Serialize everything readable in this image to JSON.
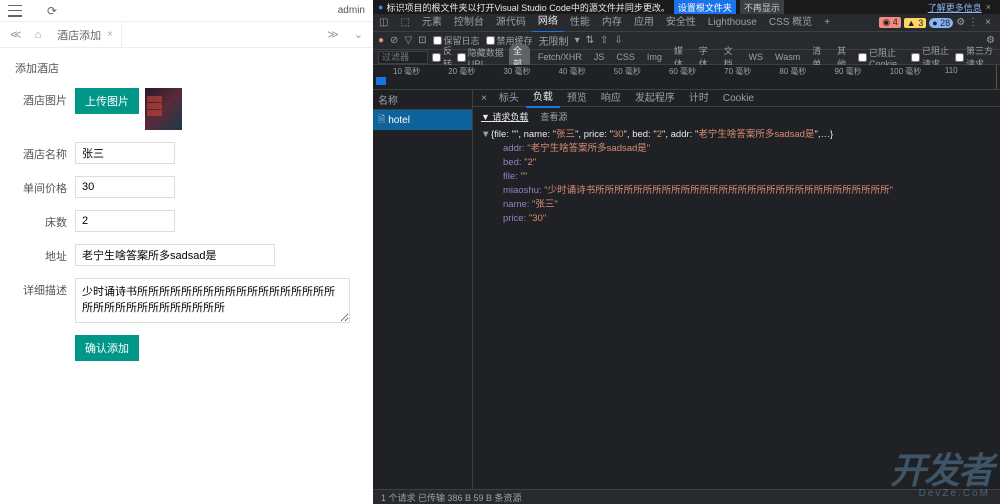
{
  "app": {
    "user": "admin",
    "tab_label": "酒店添加",
    "page_title": "添加酒店"
  },
  "form": {
    "img_label": "酒店图片",
    "upload_btn": "上传图片",
    "name_label": "酒店名称",
    "name_value": "张三",
    "price_label": "单间价格",
    "price_value": "30",
    "bed_label": "床数",
    "bed_value": "2",
    "addr_label": "地址",
    "addr_value": "老宁生啥答案所多sadsad是",
    "desc_label": "详细描述",
    "desc_value": "少时诵诗书所所所所所所所所所所所所所所所所所所所所所所所所所所所所所所所",
    "submit_btn": "确认添加"
  },
  "devtools": {
    "notice": "标识项目的根文件夹以打开Visual Studio Code中的源文件并同步更改。",
    "notice_btn1": "设置根文件夹",
    "notice_btn2": "不再显示",
    "notice_link": "了解更多信息",
    "tabs": [
      "元素",
      "控制台",
      "源代码",
      "网络",
      "性能",
      "内存",
      "应用",
      "安全性",
      "Lighthouse",
      "CSS 概览"
    ],
    "active_tab": "网络",
    "badges": {
      "err": "4",
      "warn": "3",
      "info": "28"
    },
    "filter": {
      "preserve": "保留日志",
      "disable_cache": "禁用缓存",
      "throttle": "无限制"
    },
    "types": [
      "全部",
      "Fetch/XHR",
      "JS",
      "CSS",
      "Img",
      "媒体",
      "字体",
      "文档",
      "WS",
      "Wasm",
      "清单",
      "其他"
    ],
    "checkboxes": [
      "反转",
      "隐藏数据 URL",
      "已阻止 Cookie",
      "已阻止请求",
      "第三方请求"
    ],
    "timeline": [
      "10 毫秒",
      "20 毫秒",
      "30 毫秒",
      "40 毫秒",
      "50 毫秒",
      "60 毫秒",
      "70 毫秒",
      "80 毫秒",
      "90 毫秒",
      "100 毫秒",
      "110"
    ],
    "timeline_left_label": "过滤器",
    "req_header": "名称",
    "req_item": "hotel",
    "detail_tabs": [
      "标头",
      "负载",
      "预览",
      "响应",
      "发起程序",
      "计时",
      "Cookie"
    ],
    "active_detail": "负载",
    "payload_nav": [
      "▼ 请求负载",
      "查看源"
    ],
    "json": {
      "summary_prefix": "{file: \"\", name: \"",
      "summary_name": "张三",
      "summary_mid": "\", price: \"",
      "summary_price": "30",
      "summary_mid2": "\", bed: \"",
      "summary_bed": "2",
      "summary_mid3": "\", addr: \"",
      "summary_addr": "老宁生啥答案所多sadsad是",
      "summary_end": "\",…}",
      "addr_k": "addr:",
      "addr_v": "\"老宁生啥答案所多sadsad是\"",
      "bed_k": "bed:",
      "bed_v": "\"2\"",
      "file_k": "file:",
      "file_v": "\"\"",
      "miaoshu_k": "miaoshu:",
      "miaoshu_v": "\"少时诵诗书所所所所所所所所所所所所所所所所所所所所所所所所所所所所所所所\"",
      "name_k": "name:",
      "name_v": "\"张三\"",
      "price_k": "price:",
      "price_v": "\"30\""
    },
    "status": "1 个请求  已传输 386 B  59 B 条资源"
  },
  "watermark": {
    "main": "开发者",
    "sub": "DevZe.CoM"
  }
}
